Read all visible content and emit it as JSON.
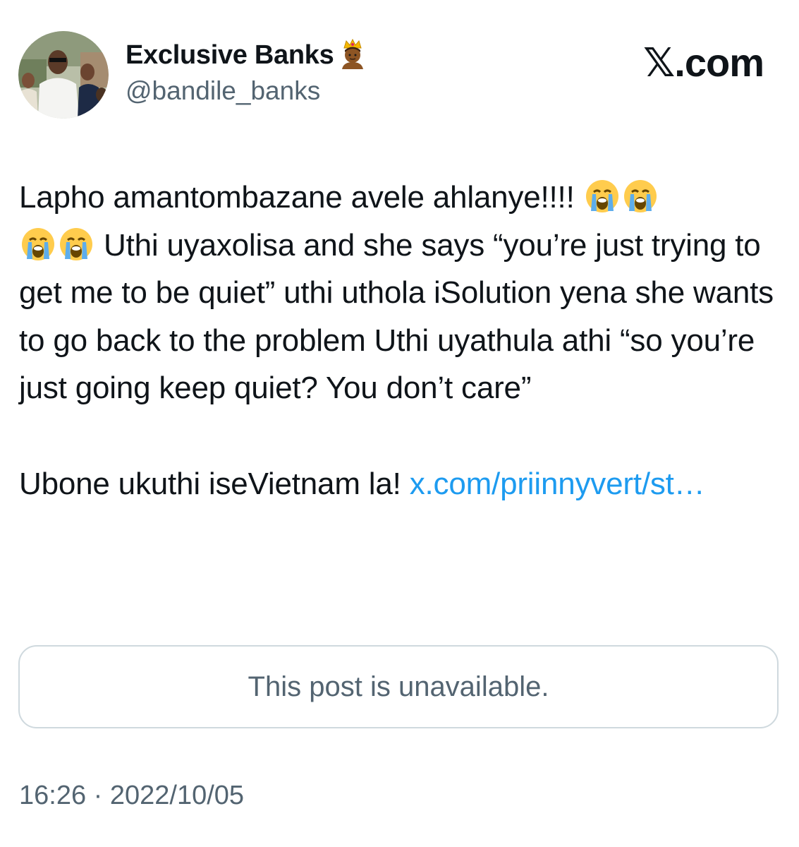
{
  "author": {
    "display_name": "Exclusive Banks",
    "name_emoji": "crown-person-emoji",
    "handle": "@bandile_banks"
  },
  "brand": {
    "x": "𝕏",
    "suffix": ".com"
  },
  "tweet": {
    "line1": "Lapho amantombazane avele ahlanye!!!! ",
    "line2": " Uthi uyaxolisa and she says “you’re just trying to get me to be quiet” uthi uthola iSolution yena she wants to go back to the problem Uthi uyathula athi “so you’re just going keep quiet? You don’t care”",
    "line3": "Ubone ukuthi iseVietnam la! ",
    "link": "x.com/priinnyvert/st…",
    "emoji": "loudly-crying-face-emoji"
  },
  "quote": {
    "text": "This post is unavailable."
  },
  "timestamp": "16:26 · 2022/10/05",
  "colors": {
    "link": "#1d9bf0",
    "secondary_text": "#536471",
    "border": "#cfd9de"
  }
}
